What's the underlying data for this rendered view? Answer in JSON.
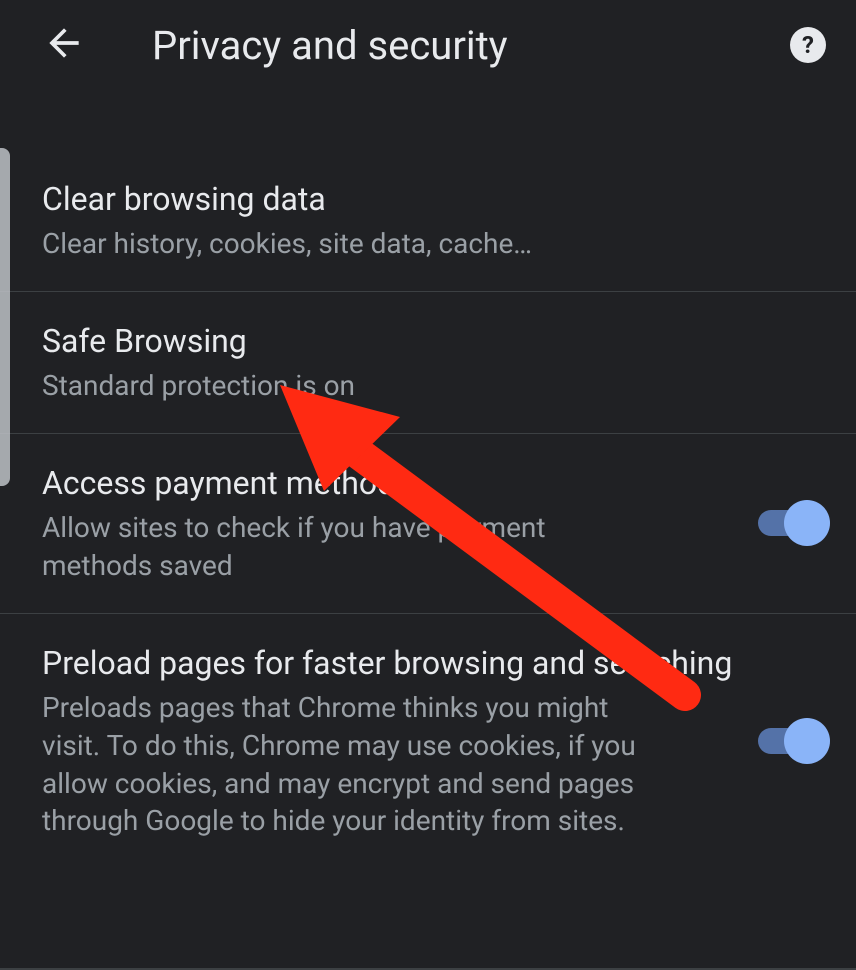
{
  "header": {
    "title": "Privacy and security"
  },
  "items": [
    {
      "title": "Clear browsing data",
      "subtitle": "Clear history, cookies, site data, cache…",
      "toggle": null
    },
    {
      "title": "Safe Browsing",
      "subtitle": "Standard protection is on",
      "toggle": null
    },
    {
      "title": "Access payment methods",
      "subtitle": "Allow sites to check if you have payment methods saved",
      "toggle": true
    },
    {
      "title": "Preload pages for faster browsing and searching",
      "subtitle": "Preloads pages that Chrome thinks you might visit. To do this, Chrome may use cookies, if you allow cookies, and may encrypt and send pages through Google to hide your identity from sites.",
      "toggle": true
    }
  ]
}
